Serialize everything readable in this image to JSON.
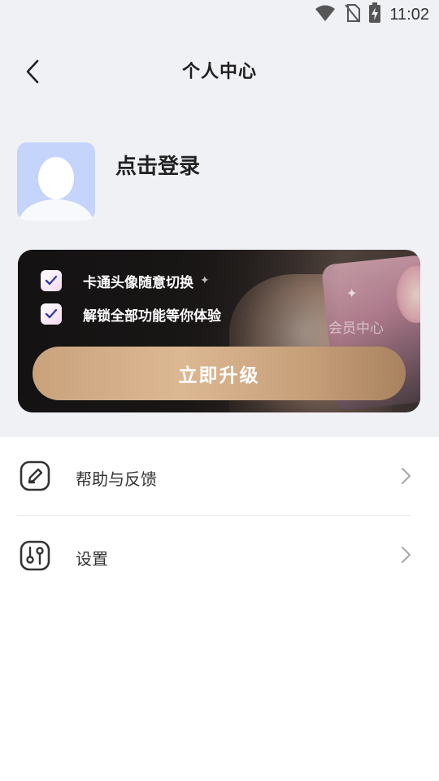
{
  "status_bar": {
    "time": "11:02",
    "icons": [
      "wifi-icon",
      "no-sim-icon",
      "battery-charging-icon"
    ]
  },
  "header": {
    "title": "个人中心",
    "back_icon": "back-chevron-icon"
  },
  "profile": {
    "login_text": "点击登录",
    "avatar_icon": "default-avatar-icon"
  },
  "vip_card": {
    "benefits": [
      {
        "text": "卡通头像随意切换",
        "checked": true
      },
      {
        "text": "解锁全部功能等你体验",
        "checked": true
      }
    ],
    "center_label": "会员中心",
    "upgrade_button": "立即升级",
    "colors": {
      "button_gold": "#d4ad86",
      "card_dark": "#1a1716"
    }
  },
  "menu": {
    "items": [
      {
        "label": "帮助与反馈",
        "icon": "edit-feedback-icon"
      },
      {
        "label": "设置",
        "icon": "settings-sliders-icon"
      }
    ]
  }
}
